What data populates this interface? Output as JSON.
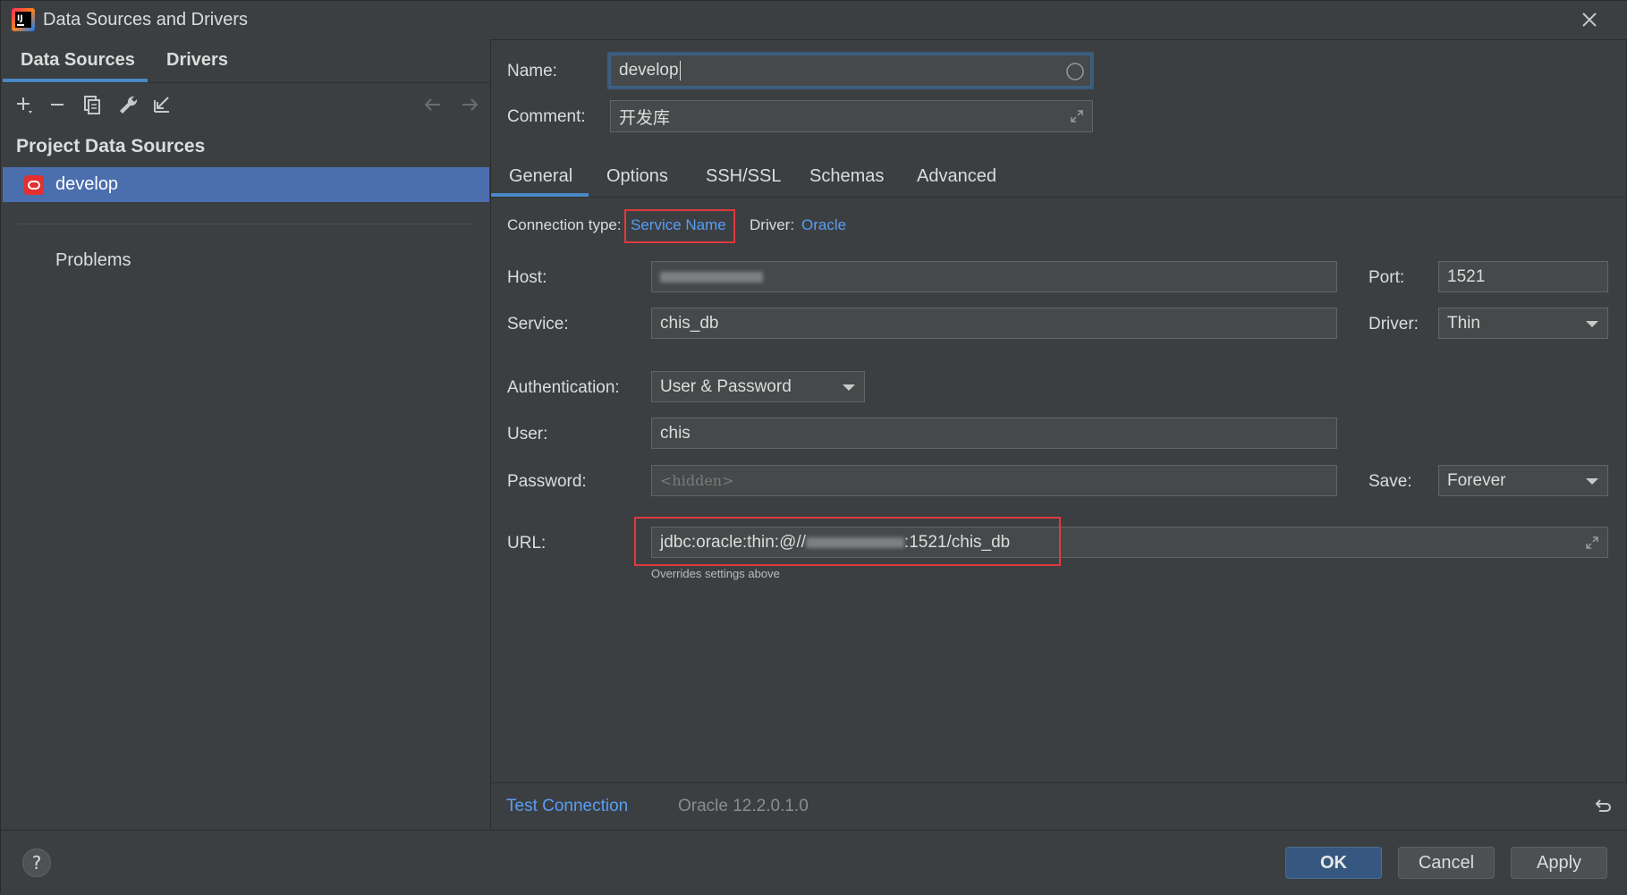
{
  "window": {
    "title": "Data Sources and Drivers"
  },
  "left": {
    "tabs": [
      {
        "label": "Data Sources"
      },
      {
        "label": "Drivers"
      }
    ],
    "toolbar": {
      "add_icon": "plus-icon",
      "remove_icon": "minus-icon",
      "duplicate_icon": "copy-icon",
      "properties_icon": "wrench-icon",
      "import_icon": "import-icon",
      "back_icon": "arrow-left-icon",
      "forward_icon": "arrow-right-icon"
    },
    "section_title": "Project Data Sources",
    "items": [
      {
        "label": "develop",
        "icon": "oracle-icon"
      }
    ],
    "problems_label": "Problems"
  },
  "form": {
    "name_label": "Name:",
    "name_value": "develop",
    "comment_label": "Comment:",
    "comment_value": "开发库",
    "tabs": [
      {
        "label": "General"
      },
      {
        "label": "Options"
      },
      {
        "label": "SSH/SSL"
      },
      {
        "label": "Schemas"
      },
      {
        "label": "Advanced"
      }
    ],
    "connection_type_label": "Connection type:",
    "connection_type_value": "Service Name",
    "driver_label": "Driver:",
    "driver_value": "Oracle",
    "host_label": "Host:",
    "port_label": "Port:",
    "port_value": "1521",
    "service_label": "Service:",
    "service_value": "chis_db",
    "driver_select_label": "Driver:",
    "driver_select_value": "Thin",
    "auth_label": "Authentication:",
    "auth_value": "User & Password",
    "user_label": "User:",
    "user_value": "chis",
    "password_label": "Password:",
    "password_placeholder": "<hidden>",
    "save_label": "Save:",
    "save_value": "Forever",
    "url_label": "URL:",
    "url_prefix": "jdbc:oracle:thin:@//",
    "url_suffix": ":1521/chis_db",
    "url_hint": "Overrides settings above"
  },
  "status": {
    "test_connection": "Test Connection",
    "driver_version": "Oracle 12.2.0.1.0",
    "revert_icon": "undo-icon"
  },
  "buttons": {
    "help": "?",
    "ok": "OK",
    "cancel": "Cancel",
    "apply": "Apply"
  }
}
